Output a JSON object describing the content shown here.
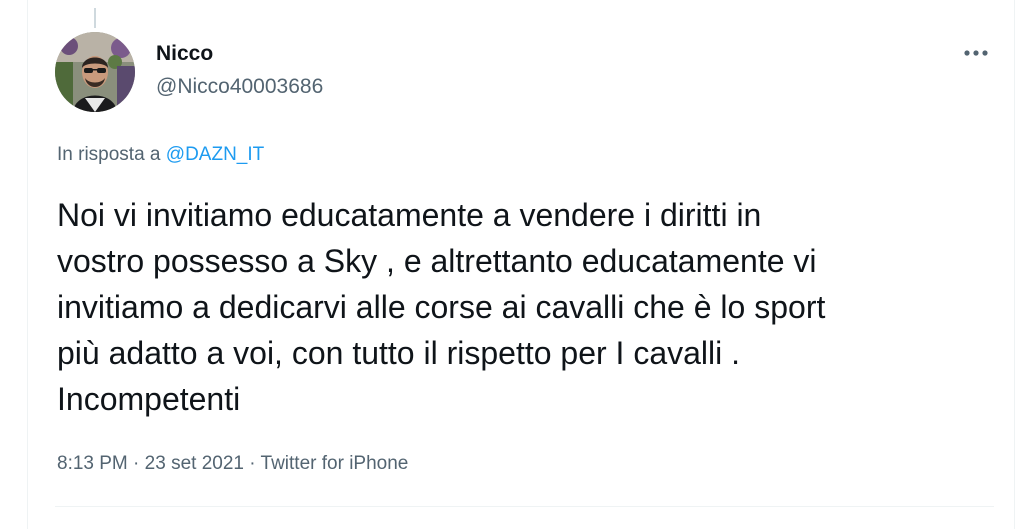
{
  "user": {
    "name": "Nicco",
    "handle": "@Nicco40003686"
  },
  "reply": {
    "prefix": "In risposta a",
    "mention": "@DAZN_IT"
  },
  "tweet": {
    "lines": [
      "Noi vi invitiamo educatamente a vendere i diritti in",
      "vostro possesso a Sky , e altrettanto educatamente vi",
      "invitiamo a dedicarvi alle corse ai cavalli che è lo sport",
      "più adatto a voi, con tutto il rispetto per I cavalli .",
      "Incompetenti"
    ]
  },
  "meta": {
    "time": "8:13 PM",
    "date": "23 set 2021",
    "source": "Twitter for iPhone",
    "separator": "·"
  },
  "icons": {
    "more": "more-horizontal-icon"
  },
  "colors": {
    "text_primary": "#0f1419",
    "text_secondary": "#536471",
    "accent": "#1d9bf0",
    "border": "#eff3f4"
  }
}
